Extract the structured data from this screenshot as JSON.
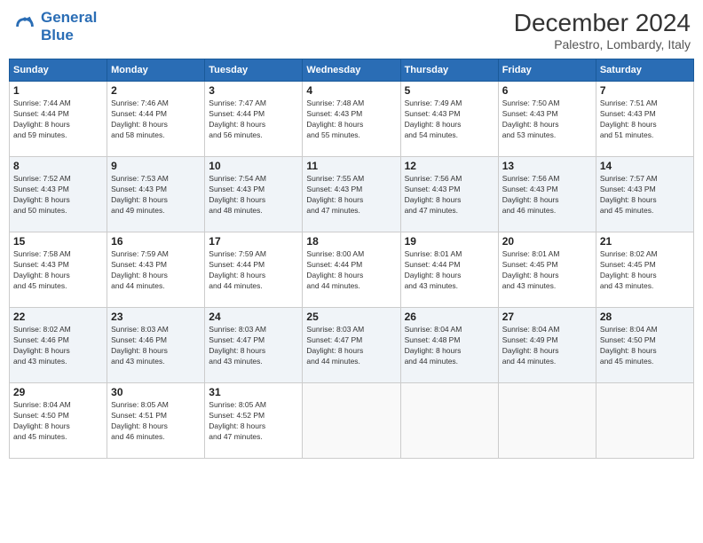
{
  "header": {
    "logo_line1": "General",
    "logo_line2": "Blue",
    "month_title": "December 2024",
    "location": "Palestro, Lombardy, Italy"
  },
  "weekdays": [
    "Sunday",
    "Monday",
    "Tuesday",
    "Wednesday",
    "Thursday",
    "Friday",
    "Saturday"
  ],
  "weeks": [
    [
      {
        "day": "1",
        "sunrise": "Sunrise: 7:44 AM",
        "sunset": "Sunset: 4:44 PM",
        "daylight": "Daylight: 8 hours and 59 minutes."
      },
      {
        "day": "2",
        "sunrise": "Sunrise: 7:46 AM",
        "sunset": "Sunset: 4:44 PM",
        "daylight": "Daylight: 8 hours and 58 minutes."
      },
      {
        "day": "3",
        "sunrise": "Sunrise: 7:47 AM",
        "sunset": "Sunset: 4:44 PM",
        "daylight": "Daylight: 8 hours and 56 minutes."
      },
      {
        "day": "4",
        "sunrise": "Sunrise: 7:48 AM",
        "sunset": "Sunset: 4:43 PM",
        "daylight": "Daylight: 8 hours and 55 minutes."
      },
      {
        "day": "5",
        "sunrise": "Sunrise: 7:49 AM",
        "sunset": "Sunset: 4:43 PM",
        "daylight": "Daylight: 8 hours and 54 minutes."
      },
      {
        "day": "6",
        "sunrise": "Sunrise: 7:50 AM",
        "sunset": "Sunset: 4:43 PM",
        "daylight": "Daylight: 8 hours and 53 minutes."
      },
      {
        "day": "7",
        "sunrise": "Sunrise: 7:51 AM",
        "sunset": "Sunset: 4:43 PM",
        "daylight": "Daylight: 8 hours and 51 minutes."
      }
    ],
    [
      {
        "day": "8",
        "sunrise": "Sunrise: 7:52 AM",
        "sunset": "Sunset: 4:43 PM",
        "daylight": "Daylight: 8 hours and 50 minutes."
      },
      {
        "day": "9",
        "sunrise": "Sunrise: 7:53 AM",
        "sunset": "Sunset: 4:43 PM",
        "daylight": "Daylight: 8 hours and 49 minutes."
      },
      {
        "day": "10",
        "sunrise": "Sunrise: 7:54 AM",
        "sunset": "Sunset: 4:43 PM",
        "daylight": "Daylight: 8 hours and 48 minutes."
      },
      {
        "day": "11",
        "sunrise": "Sunrise: 7:55 AM",
        "sunset": "Sunset: 4:43 PM",
        "daylight": "Daylight: 8 hours and 47 minutes."
      },
      {
        "day": "12",
        "sunrise": "Sunrise: 7:56 AM",
        "sunset": "Sunset: 4:43 PM",
        "daylight": "Daylight: 8 hours and 47 minutes."
      },
      {
        "day": "13",
        "sunrise": "Sunrise: 7:56 AM",
        "sunset": "Sunset: 4:43 PM",
        "daylight": "Daylight: 8 hours and 46 minutes."
      },
      {
        "day": "14",
        "sunrise": "Sunrise: 7:57 AM",
        "sunset": "Sunset: 4:43 PM",
        "daylight": "Daylight: 8 hours and 45 minutes."
      }
    ],
    [
      {
        "day": "15",
        "sunrise": "Sunrise: 7:58 AM",
        "sunset": "Sunset: 4:43 PM",
        "daylight": "Daylight: 8 hours and 45 minutes."
      },
      {
        "day": "16",
        "sunrise": "Sunrise: 7:59 AM",
        "sunset": "Sunset: 4:43 PM",
        "daylight": "Daylight: 8 hours and 44 minutes."
      },
      {
        "day": "17",
        "sunrise": "Sunrise: 7:59 AM",
        "sunset": "Sunset: 4:44 PM",
        "daylight": "Daylight: 8 hours and 44 minutes."
      },
      {
        "day": "18",
        "sunrise": "Sunrise: 8:00 AM",
        "sunset": "Sunset: 4:44 PM",
        "daylight": "Daylight: 8 hours and 44 minutes."
      },
      {
        "day": "19",
        "sunrise": "Sunrise: 8:01 AM",
        "sunset": "Sunset: 4:44 PM",
        "daylight": "Daylight: 8 hours and 43 minutes."
      },
      {
        "day": "20",
        "sunrise": "Sunrise: 8:01 AM",
        "sunset": "Sunset: 4:45 PM",
        "daylight": "Daylight: 8 hours and 43 minutes."
      },
      {
        "day": "21",
        "sunrise": "Sunrise: 8:02 AM",
        "sunset": "Sunset: 4:45 PM",
        "daylight": "Daylight: 8 hours and 43 minutes."
      }
    ],
    [
      {
        "day": "22",
        "sunrise": "Sunrise: 8:02 AM",
        "sunset": "Sunset: 4:46 PM",
        "daylight": "Daylight: 8 hours and 43 minutes."
      },
      {
        "day": "23",
        "sunrise": "Sunrise: 8:03 AM",
        "sunset": "Sunset: 4:46 PM",
        "daylight": "Daylight: 8 hours and 43 minutes."
      },
      {
        "day": "24",
        "sunrise": "Sunrise: 8:03 AM",
        "sunset": "Sunset: 4:47 PM",
        "daylight": "Daylight: 8 hours and 43 minutes."
      },
      {
        "day": "25",
        "sunrise": "Sunrise: 8:03 AM",
        "sunset": "Sunset: 4:47 PM",
        "daylight": "Daylight: 8 hours and 44 minutes."
      },
      {
        "day": "26",
        "sunrise": "Sunrise: 8:04 AM",
        "sunset": "Sunset: 4:48 PM",
        "daylight": "Daylight: 8 hours and 44 minutes."
      },
      {
        "day": "27",
        "sunrise": "Sunrise: 8:04 AM",
        "sunset": "Sunset: 4:49 PM",
        "daylight": "Daylight: 8 hours and 44 minutes."
      },
      {
        "day": "28",
        "sunrise": "Sunrise: 8:04 AM",
        "sunset": "Sunset: 4:50 PM",
        "daylight": "Daylight: 8 hours and 45 minutes."
      }
    ],
    [
      {
        "day": "29",
        "sunrise": "Sunrise: 8:04 AM",
        "sunset": "Sunset: 4:50 PM",
        "daylight": "Daylight: 8 hours and 45 minutes."
      },
      {
        "day": "30",
        "sunrise": "Sunrise: 8:05 AM",
        "sunset": "Sunset: 4:51 PM",
        "daylight": "Daylight: 8 hours and 46 minutes."
      },
      {
        "day": "31",
        "sunrise": "Sunrise: 8:05 AM",
        "sunset": "Sunset: 4:52 PM",
        "daylight": "Daylight: 8 hours and 47 minutes."
      },
      null,
      null,
      null,
      null
    ]
  ]
}
